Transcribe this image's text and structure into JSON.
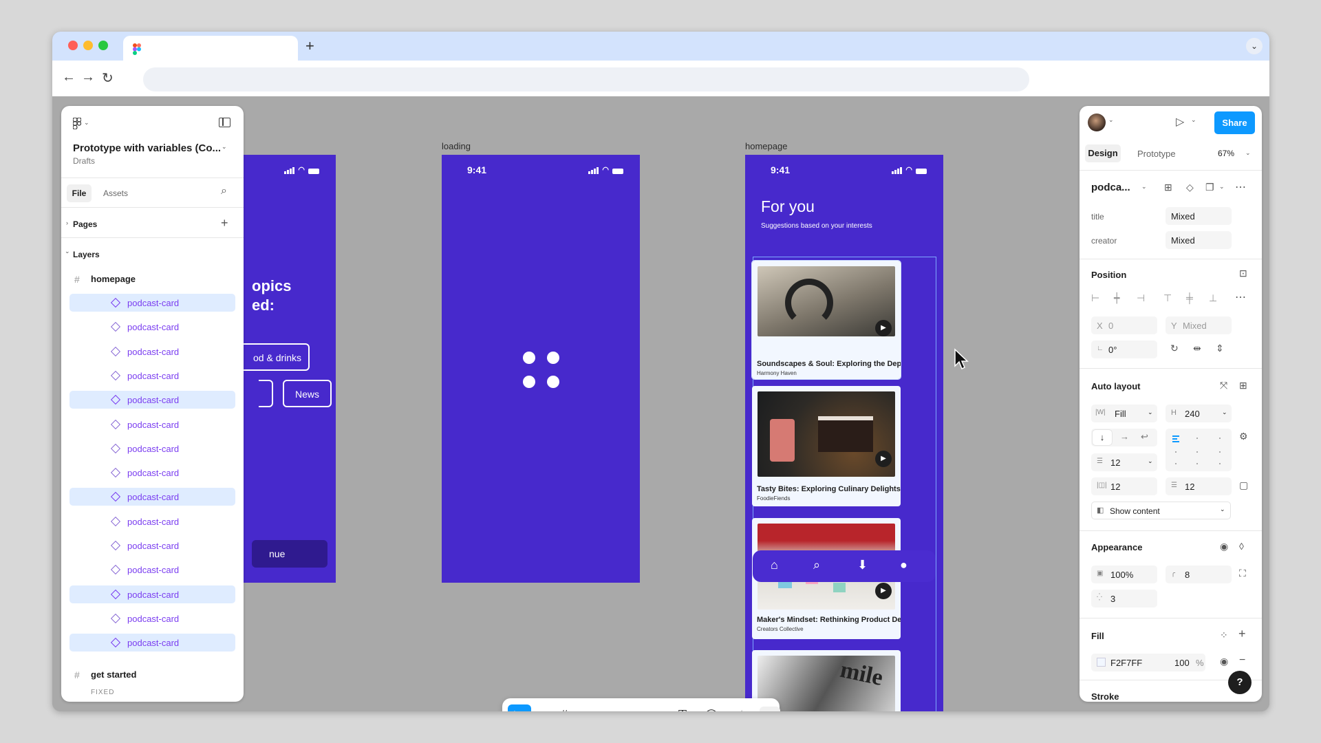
{
  "browser": {
    "new_tab": "+",
    "tab_menu": "⌄",
    "back": "←",
    "forward": "→",
    "reload": "↻"
  },
  "left_panel": {
    "file_title": "Prototype with variables (Co...",
    "file_location": "Drafts",
    "tabs": [
      {
        "label": "File"
      },
      {
        "label": "Assets"
      }
    ],
    "pages_label": "Pages",
    "layers_label": "Layers",
    "frame_homepage": "homepage",
    "layers": [
      {
        "label": "podcast-card",
        "selected": true
      },
      {
        "label": "podcast-card",
        "selected": false
      },
      {
        "label": "podcast-card",
        "selected": false
      },
      {
        "label": "podcast-card",
        "selected": false
      },
      {
        "label": "podcast-card",
        "selected": true
      },
      {
        "label": "podcast-card",
        "selected": false
      },
      {
        "label": "podcast-card",
        "selected": false
      },
      {
        "label": "podcast-card",
        "selected": false
      },
      {
        "label": "podcast-card",
        "selected": true
      },
      {
        "label": "podcast-card",
        "selected": false
      },
      {
        "label": "podcast-card",
        "selected": false
      },
      {
        "label": "podcast-card",
        "selected": false
      },
      {
        "label": "podcast-card",
        "selected": true
      },
      {
        "label": "podcast-card",
        "selected": false
      },
      {
        "label": "podcast-card",
        "selected": true
      }
    ],
    "frame_get_started": "get started",
    "fixed_label": "FIXED"
  },
  "canvas": {
    "get_started": {
      "title_partial": "opics",
      "title_partial2": "ed:",
      "chip1": "od & drinks",
      "chip2": "News",
      "button_partial": "nue"
    },
    "loading": {
      "label": "loading",
      "time": "9:41"
    },
    "homepage": {
      "label": "homepage",
      "time": "9:41",
      "heading": "For you",
      "subheading": "Suggestions based on your interests",
      "cards": [
        {
          "title": "Soundscapes & Soul: Exploring the Depths of...",
          "creator": "Harmony Haven"
        },
        {
          "title": "Tasty Bites: Exploring Culinary Delights",
          "creator": "FoodieFiends"
        },
        {
          "title": "Maker's Mindset: Rethinking Product Design",
          "creator": "Creators Collective"
        }
      ],
      "partial_card_text": "mile"
    }
  },
  "right_panel": {
    "share_label": "Share",
    "tabs": [
      {
        "label": "Design"
      },
      {
        "label": "Prototype"
      }
    ],
    "zoom": "67%",
    "component_name": "podca...",
    "props": [
      {
        "label": "title",
        "value": "Mixed"
      },
      {
        "label": "creator",
        "value": "Mixed"
      }
    ],
    "position_label": "Position",
    "x_label": "X",
    "x_value": "0",
    "y_label": "Y",
    "y_value": "Mixed",
    "rotation": "0°",
    "auto_layout_label": "Auto layout",
    "width_mode": "Fill",
    "height_value": "240",
    "gap": "12",
    "padding_h": "12",
    "padding_v": "12",
    "clip_label": "Show content",
    "appearance_label": "Appearance",
    "opacity": "100%",
    "radius": "8",
    "blur": "3",
    "fill_label": "Fill",
    "fill_hex": "F2F7FF",
    "fill_opacity": "100",
    "fill_pct": "%",
    "stroke_label": "Stroke",
    "help": "?"
  },
  "colors": {
    "accent": "#4729cc",
    "blue": "#0d99ff",
    "card_bg": "#f2f7ff"
  }
}
